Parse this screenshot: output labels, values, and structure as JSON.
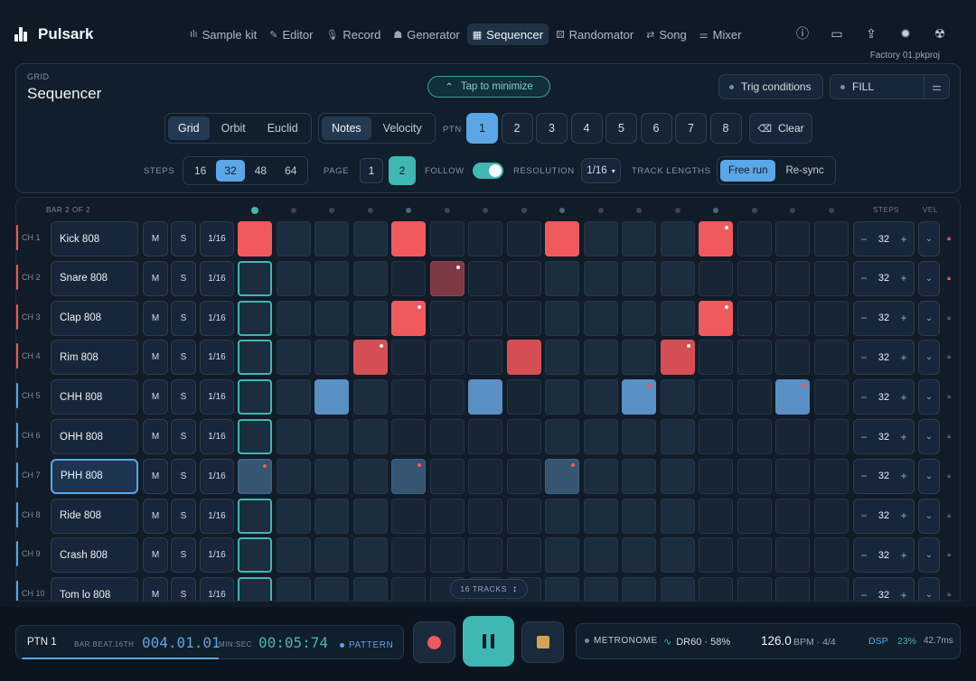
{
  "app": {
    "name": "Pulsark",
    "project": "Factory 01.pkproj"
  },
  "nav": [
    {
      "label": "Sample kit",
      "icon": "waveform-icon",
      "glyph": "ılı"
    },
    {
      "label": "Editor",
      "icon": "pencil-icon",
      "glyph": "✎"
    },
    {
      "label": "Record",
      "icon": "microphone-icon",
      "glyph": "🎙"
    },
    {
      "label": "Generator",
      "icon": "robot-icon",
      "glyph": "☗"
    },
    {
      "label": "Sequencer",
      "icon": "grid-icon",
      "glyph": "▦",
      "active": true
    },
    {
      "label": "Randomator",
      "icon": "dice-icon",
      "glyph": "⚄"
    },
    {
      "label": "Song",
      "icon": "repeat-icon",
      "glyph": "⇄"
    },
    {
      "label": "Mixer",
      "icon": "sliders-icon",
      "glyph": "⚌"
    }
  ],
  "top_icons": [
    "info-icon",
    "folder-icon",
    "upload-icon",
    "settings-icon",
    "radiation-icon"
  ],
  "panel": {
    "kicker": "GRID",
    "title": "Sequencer",
    "minimize_label": "Tap to minimize",
    "trig_label": "Trig conditions",
    "fill_label": "FILL",
    "view_modes": [
      "Grid",
      "Orbit",
      "Euclid"
    ],
    "view_mode_selected": "Grid",
    "data_modes": [
      "Notes",
      "Velocity"
    ],
    "data_mode_selected": "Notes",
    "ptn_label": "PTN",
    "patterns": [
      "1",
      "2",
      "3",
      "4",
      "5",
      "6",
      "7",
      "8"
    ],
    "pattern_selected": "1",
    "clear_label": "Clear",
    "steps_label": "STEPS",
    "steps_options": [
      "16",
      "32",
      "48",
      "64"
    ],
    "steps_selected": "32",
    "page_label": "PAGE",
    "pages": [
      "1",
      "2"
    ],
    "page_selected": "2",
    "follow_label": "FOLLOW",
    "follow_on": true,
    "resolution_label": "RESOLUTION",
    "resolution_value": "1/16",
    "track_lengths_label": "TRACK LENGTHS",
    "track_length_modes": [
      "Free run",
      "Re-sync"
    ],
    "track_length_selected": "Free run"
  },
  "grid": {
    "bar_label": "BAR 2 OF 2",
    "steps_header": "STEPS",
    "vel_header": "VEL",
    "tracks_pill": "16 TRACKS",
    "tracks": [
      {
        "ch": "CH 1",
        "name": "Kick 808",
        "color": "#f0595e",
        "res": "1/16",
        "steps": "32",
        "locked": true
      },
      {
        "ch": "CH 2",
        "name": "Snare 808",
        "color": "#f0595e",
        "res": "1/16",
        "steps": "32",
        "locked": true
      },
      {
        "ch": "CH 3",
        "name": "Clap 808",
        "color": "#f0595e",
        "res": "1/16",
        "steps": "32",
        "locked": false
      },
      {
        "ch": "CH 4",
        "name": "Rim 808",
        "color": "#f0595e",
        "res": "1/16",
        "steps": "32",
        "locked": false
      },
      {
        "ch": "CH 5",
        "name": "CHH 808",
        "color": "#5aa6e6",
        "res": "1/16",
        "steps": "32",
        "locked": false
      },
      {
        "ch": "CH 6",
        "name": "OHH 808",
        "color": "#5aa6e6",
        "res": "1/16",
        "steps": "32",
        "locked": false
      },
      {
        "ch": "CH 7",
        "name": "PHH 808",
        "color": "#5aa6e6",
        "res": "1/16",
        "steps": "32",
        "locked": false,
        "selected": true
      },
      {
        "ch": "CH 8",
        "name": "Ride 808",
        "color": "#5aa6e6",
        "res": "1/16",
        "steps": "32",
        "locked": false
      },
      {
        "ch": "CH 9",
        "name": "Crash 808",
        "color": "#5aa6e6",
        "res": "1/16",
        "steps": "32",
        "locked": false
      },
      {
        "ch": "CH 10",
        "name": "Tom lo 808",
        "color": "#5aa6e6",
        "res": "1/16",
        "steps": "32",
        "locked": false
      }
    ],
    "mute_label": "M",
    "solo_label": "S",
    "minus": "−",
    "plus": "+",
    "vel_glyph": "⌄"
  },
  "footer": {
    "ptn": "PTN 1",
    "bbt_label": "BAR.BEAT.16TH",
    "bbt_value": "004.01.01",
    "time_label": "MIN:SEC",
    "time_value": "00:05:74",
    "mode_label": "PATTERN",
    "metronome_label": "METRONOME",
    "dr_value": "DR60 · 58%",
    "bpm_value": "126.0",
    "bpm_unit": "BPM · 4/4",
    "dsp_label": "DSP",
    "dsp_value": "23%",
    "latency": "42.7ms",
    "progress": 0.52
  }
}
